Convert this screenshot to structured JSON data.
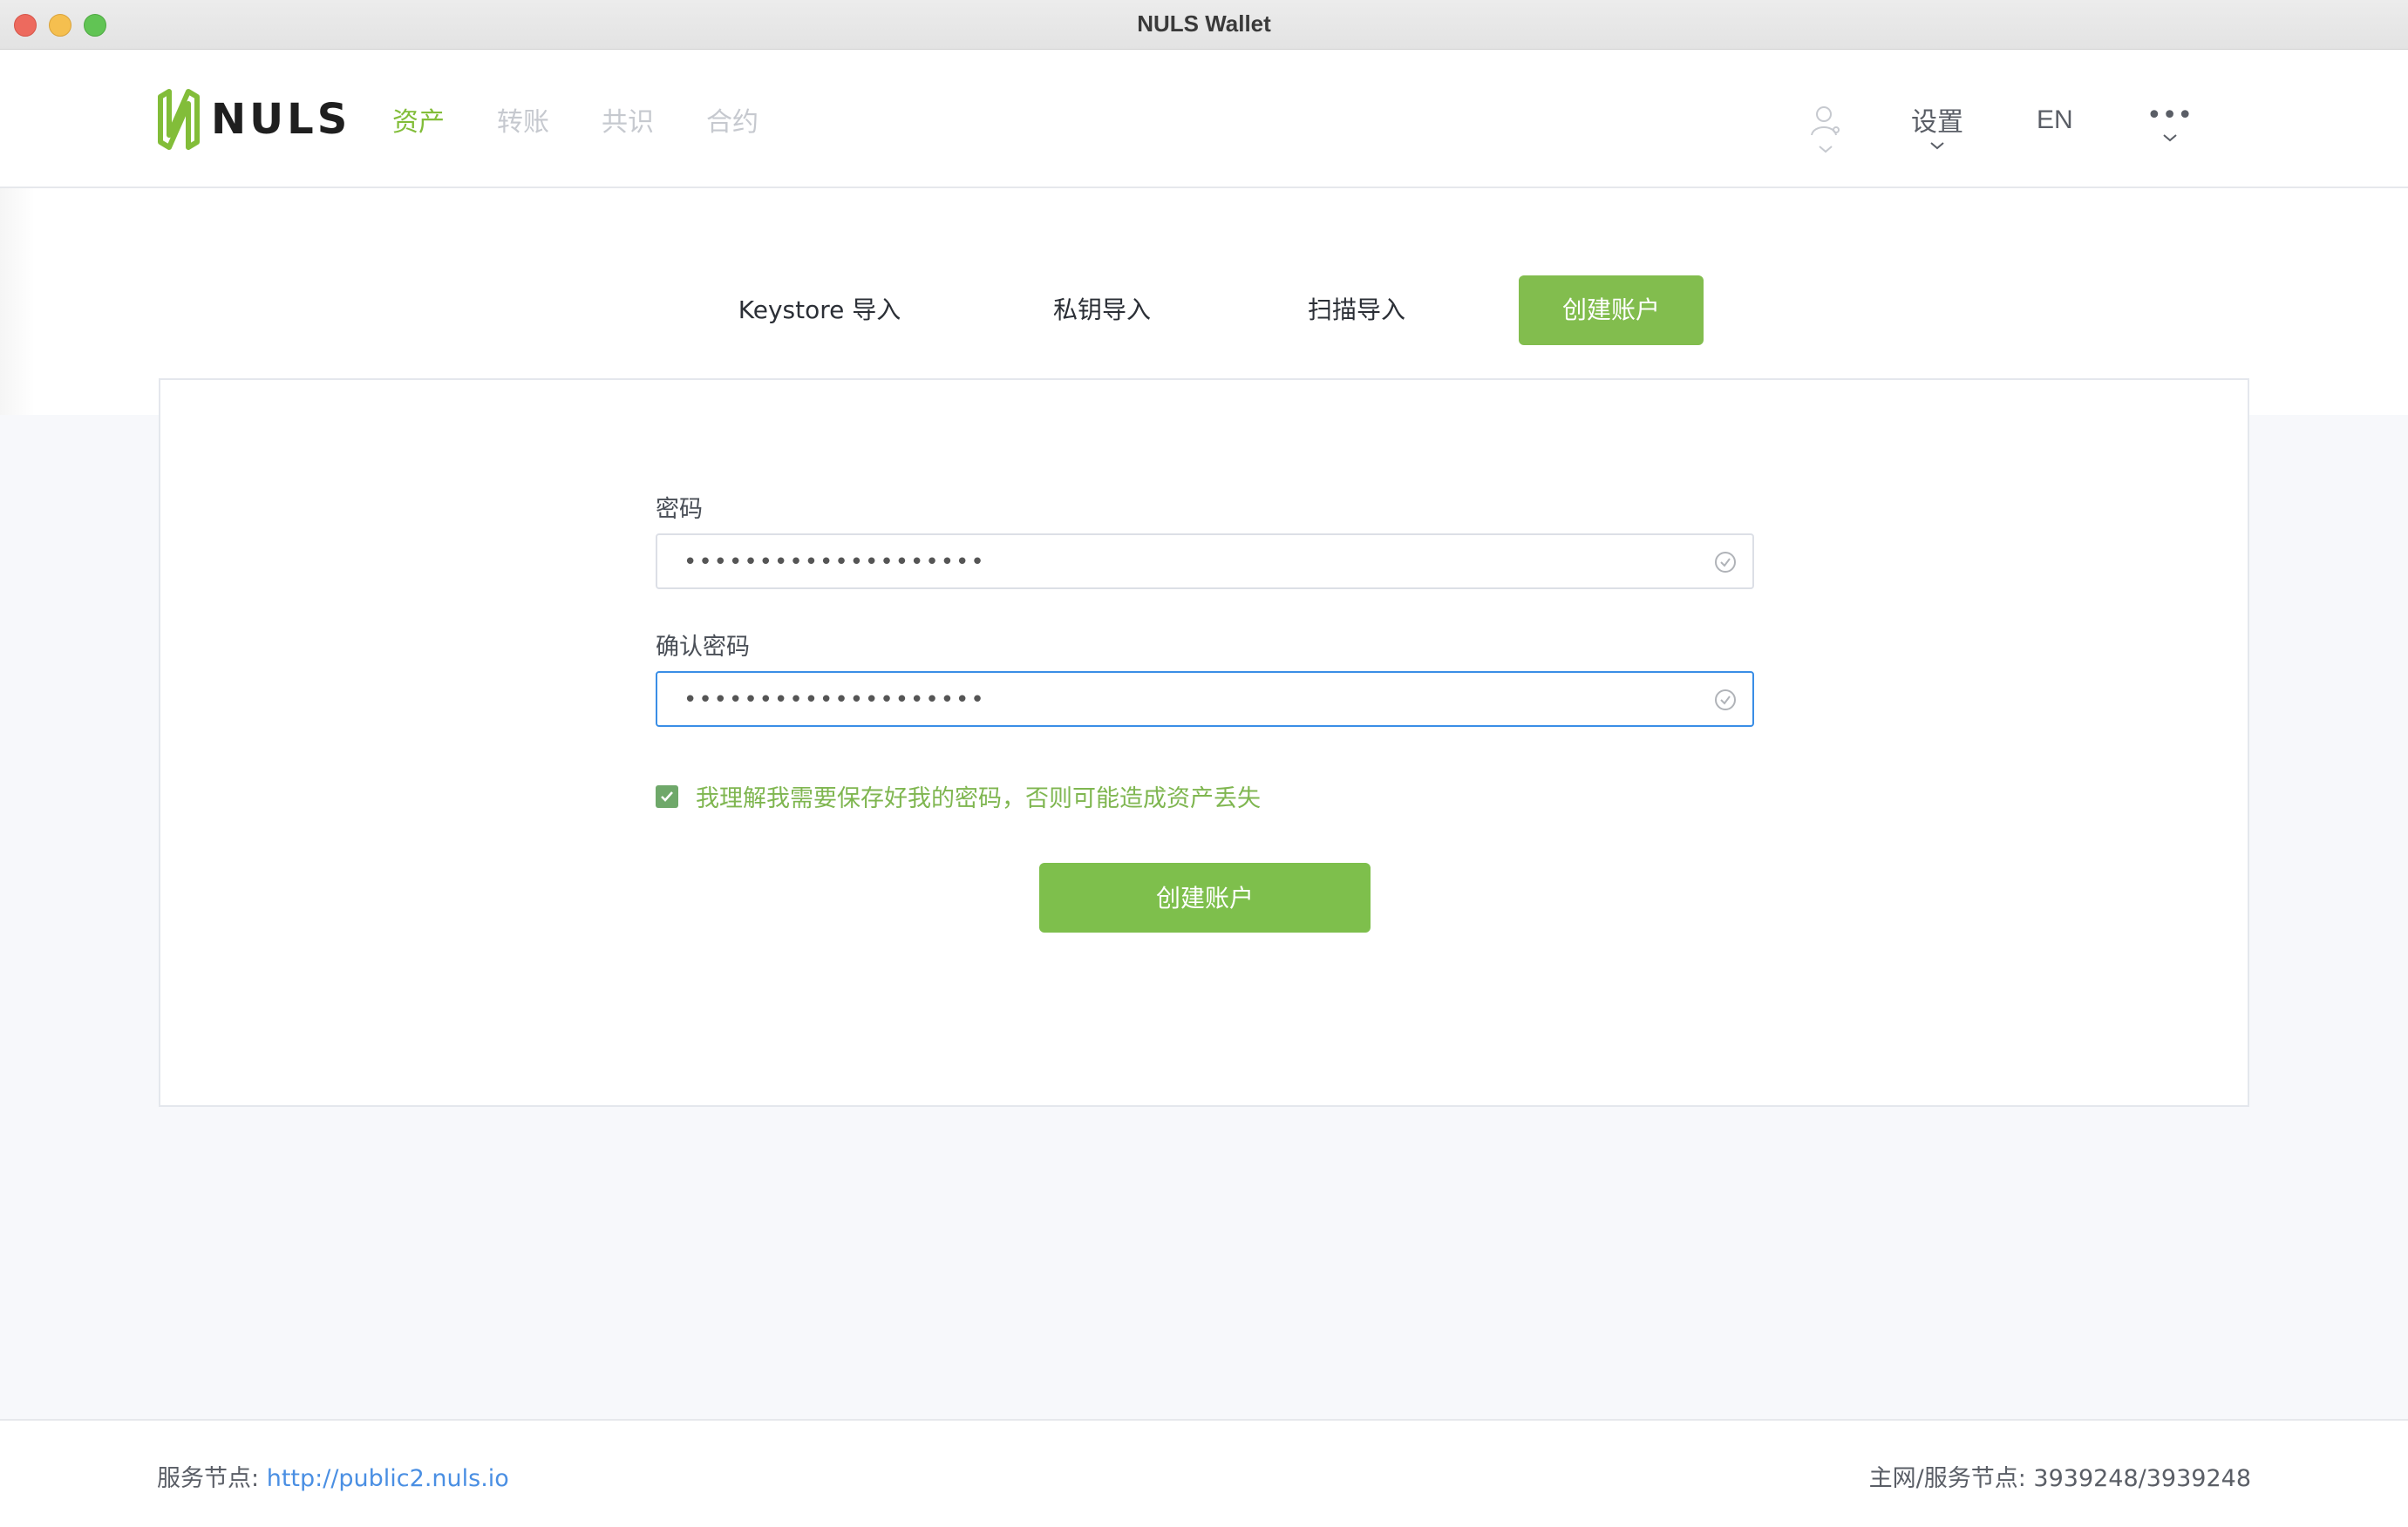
{
  "window": {
    "title": "NULS Wallet"
  },
  "header": {
    "logo_text": "NULS",
    "nav": [
      {
        "label": "资产",
        "active": true
      },
      {
        "label": "转账",
        "active": false
      },
      {
        "label": "共识",
        "active": false
      },
      {
        "label": "合约",
        "active": false
      }
    ],
    "settings_label": "设置",
    "lang_label": "EN",
    "more_label": "•••"
  },
  "tabs": [
    {
      "label": "Keystore 导入",
      "active": false
    },
    {
      "label": "私钥导入",
      "active": false
    },
    {
      "label": "扫描导入",
      "active": false
    },
    {
      "label": "创建账户",
      "active": true
    }
  ],
  "form": {
    "password_label": "密码",
    "password_value": "••••••••••••••••••••",
    "confirm_label": "确认密码",
    "confirm_value": "••••••••••••••••••••",
    "agree_text": "我理解我需要保存好我的密码，否则可能造成资产丢失",
    "agree_checked": true,
    "submit_label": "创建账户"
  },
  "footer": {
    "node_label": "服务节点:",
    "node_url": "http://public2.nuls.io",
    "height_label": "主网/服务节点:",
    "height_value": "3939248/3939248"
  },
  "colors": {
    "accent": "#82bd4e",
    "link": "#4a8fe3",
    "focus": "#3a8ee6"
  }
}
